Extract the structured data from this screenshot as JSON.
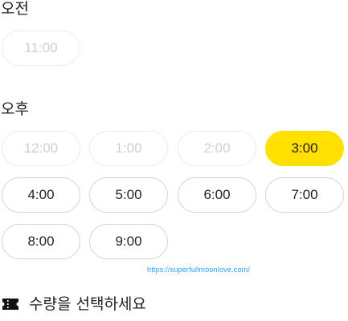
{
  "morning": {
    "title": "오전",
    "slots": [
      {
        "label": "11:00",
        "state": "disabled"
      }
    ]
  },
  "afternoon": {
    "title": "오후",
    "slots": [
      {
        "label": "12:00",
        "state": "disabled"
      },
      {
        "label": "1:00",
        "state": "disabled"
      },
      {
        "label": "2:00",
        "state": "disabled"
      },
      {
        "label": "3:00",
        "state": "selected"
      },
      {
        "label": "4:00",
        "state": "available"
      },
      {
        "label": "5:00",
        "state": "available"
      },
      {
        "label": "6:00",
        "state": "available"
      },
      {
        "label": "7:00",
        "state": "available"
      },
      {
        "label": "8:00",
        "state": "available"
      },
      {
        "label": "9:00",
        "state": "available"
      }
    ]
  },
  "watermark": "https://superfullmoonlove.com/",
  "quantity": {
    "icon": "ticket-icon",
    "label": "수량을 선택하세요"
  },
  "colors": {
    "selected": "#ffe000",
    "border": "#d3d3d3",
    "disabled_text": "#cfcfcf",
    "watermark": "#1ea0ff"
  }
}
